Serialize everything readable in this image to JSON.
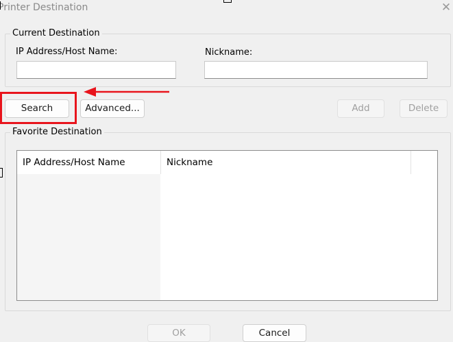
{
  "window": {
    "title": "Printer Destination",
    "close_glyph": "✕"
  },
  "current_destination": {
    "legend": "Current Destination",
    "ip_label": "IP Address/Host Name:",
    "ip_value": "",
    "nickname_label": "Nickname:",
    "nickname_value": ""
  },
  "buttons": {
    "search": "Search",
    "advanced": "Advanced...",
    "add": "Add",
    "delete": "Delete",
    "ok": "OK",
    "cancel": "Cancel"
  },
  "favorite_destination": {
    "legend": "Favorite Destination",
    "columns": [
      "IP Address/Host Name",
      "Nickname"
    ],
    "sort_glyph": "^",
    "rows": []
  },
  "annotation": {
    "highlight_color": "#e8141c",
    "arrow_color": "#e8141c"
  }
}
